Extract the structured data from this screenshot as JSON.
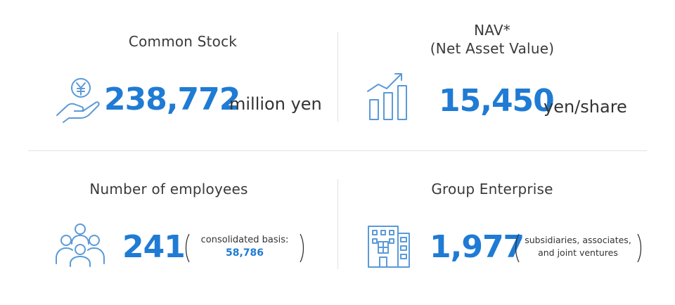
{
  "blocks": {
    "common_stock": {
      "title": "Common Stock",
      "value": "238,772",
      "unit": "million yen",
      "icon": "yen-coin-hand-icon"
    },
    "nav": {
      "title_line1": "NAV*",
      "title_line2": "(Net Asset Value)",
      "value": "15,450",
      "unit": "yen/share",
      "icon": "bar-chart-growth-icon"
    },
    "employees": {
      "title": "Number of employees",
      "value": "241",
      "note_label": "consolidated basis:",
      "note_value": "58,786",
      "icon": "people-group-icon"
    },
    "group": {
      "title": "Group Enterprise",
      "value": "1,977",
      "note_line1": "subsidiaries, associates,",
      "note_line2": "and joint ventures",
      "icon": "building-icon"
    }
  },
  "colors": {
    "accent": "#1f7bd4",
    "icon_stroke": "#5a9ad8",
    "text": "#333333",
    "divider": "#e1e1e1"
  }
}
